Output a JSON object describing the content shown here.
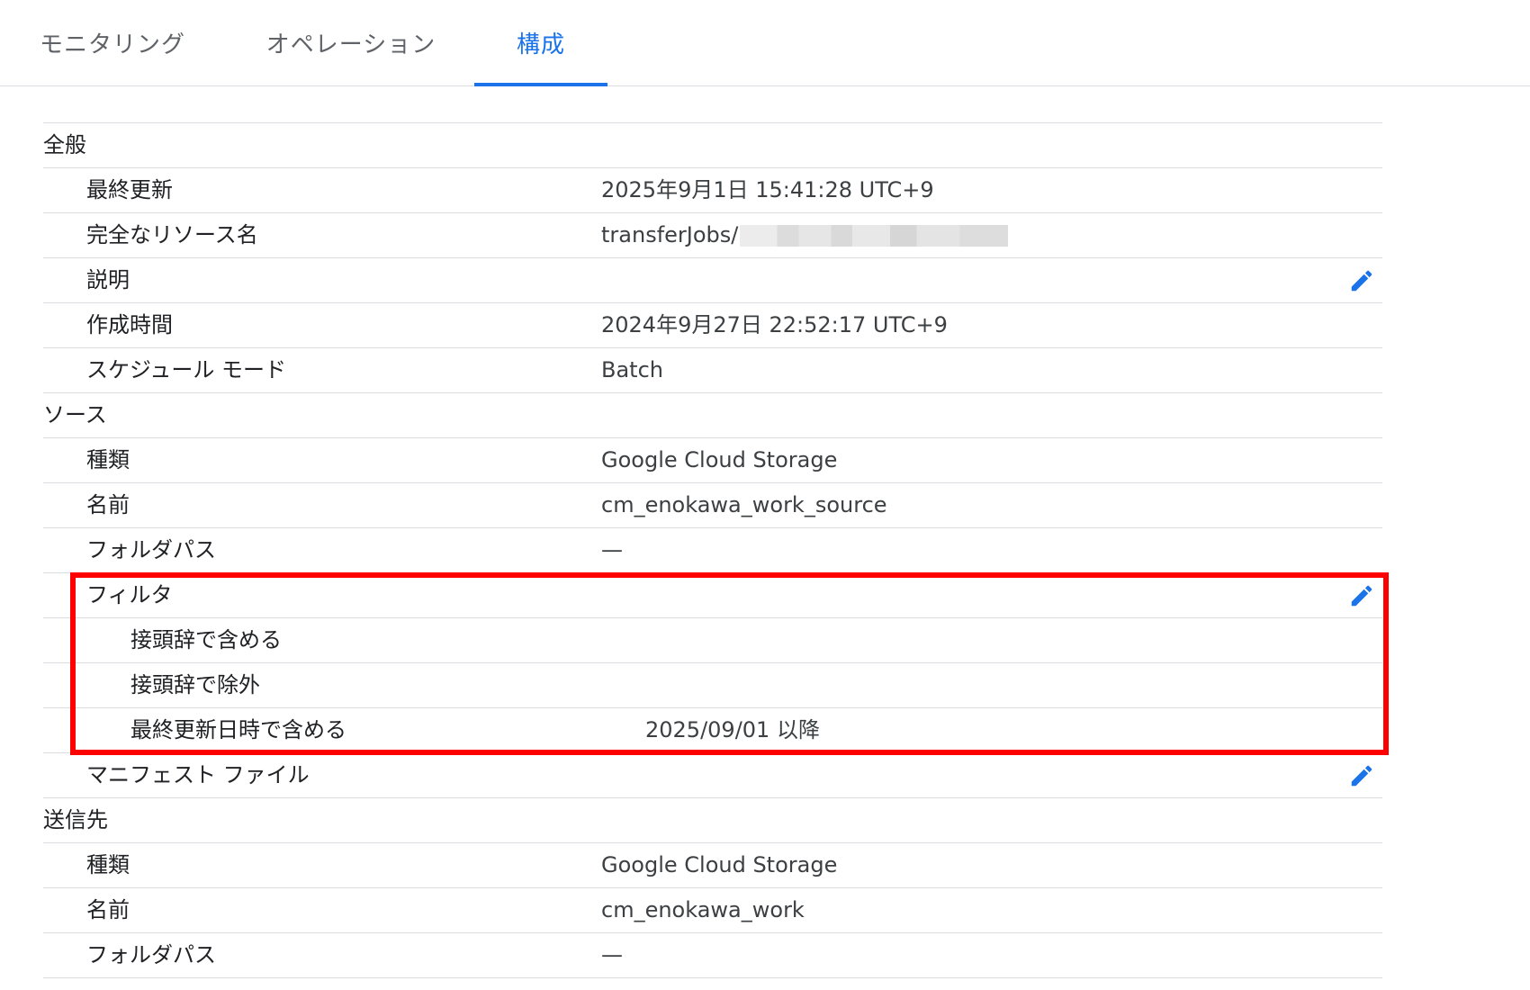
{
  "tabs": [
    {
      "label": "モニタリング",
      "active": false
    },
    {
      "label": "オペレーション",
      "active": false
    },
    {
      "label": "構成",
      "active": true
    }
  ],
  "sections": {
    "general": {
      "title": "全般",
      "last_updated_label": "最終更新",
      "last_updated_value": "2025年9月1日 15:41:28 UTC+9",
      "resource_name_label": "完全なリソース名",
      "resource_name_value": "transferJobs/",
      "description_label": "説明",
      "created_label": "作成時間",
      "created_value": "2024年9月27日 22:52:17 UTC+9",
      "schedule_mode_label": "スケジュール モード",
      "schedule_mode_value": "Batch"
    },
    "source": {
      "title": "ソース",
      "type_label": "種類",
      "type_value": "Google Cloud Storage",
      "name_label": "名前",
      "name_value": "cm_enokawa_work_source",
      "folder_label": "フォルダパス",
      "folder_value": "—",
      "filter_label": "フィルタ",
      "include_prefix_label": "接頭辞で含める",
      "exclude_prefix_label": "接頭辞で除外",
      "include_modified_label": "最終更新日時で含める",
      "include_modified_value": "2025/09/01 以降",
      "manifest_label": "マニフェスト ファイル"
    },
    "destination": {
      "title": "送信先",
      "type_label": "種類",
      "type_value": "Google Cloud Storage",
      "name_label": "名前",
      "name_value": "cm_enokawa_work",
      "folder_label": "フォルダパス",
      "folder_value": "—"
    }
  },
  "icons": {
    "edit": "pencil-icon"
  },
  "colors": {
    "accent": "#1a73e8",
    "highlight": "#ff0000",
    "divider": "#dadce0"
  }
}
